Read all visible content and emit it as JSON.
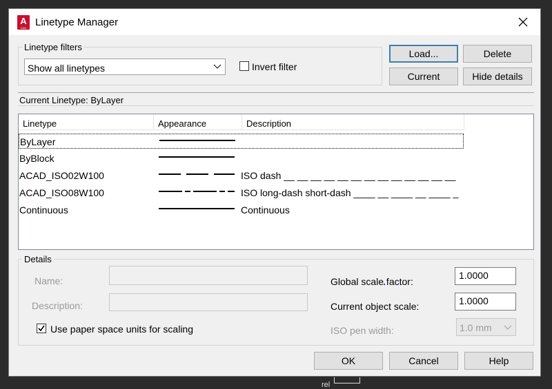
{
  "window": {
    "title": "Linetype Manager",
    "app_icon_letter": "A",
    "app_icon_sub": "CAD"
  },
  "filters": {
    "group_label": "Linetype filters",
    "selected": "Show all linetypes",
    "invert_label": "Invert filter",
    "invert_checked": false
  },
  "buttons": {
    "load": "Load...",
    "delete": "Delete",
    "current": "Current",
    "hide_details": "Hide details",
    "ok": "OK",
    "cancel": "Cancel",
    "help": "Help"
  },
  "current_linetype": {
    "label": "Current Linetype:",
    "value": "ByLayer"
  },
  "table": {
    "columns": [
      "Linetype",
      "Appearance",
      "Description"
    ],
    "rows": [
      {
        "linetype": "ByLayer",
        "appearance": "solid",
        "description": ""
      },
      {
        "linetype": "ByBlock",
        "appearance": "solid",
        "description": ""
      },
      {
        "linetype": "ACAD_ISO02W100",
        "appearance": "dash",
        "description": "ISO dash __ __ __ __ __ __ __ __ __ __ __ __ __"
      },
      {
        "linetype": "ACAD_ISO08W100",
        "appearance": "long-dash-short-dash",
        "description": "ISO long-dash short-dash ____ __ ____ __ ____ _"
      },
      {
        "linetype": "Continuous",
        "appearance": "solid",
        "description": "Continuous"
      }
    ]
  },
  "details": {
    "group_label": "Details",
    "name_label": "Name:",
    "description_label": "Description:",
    "paper_space_label": "Use paper space units for scaling",
    "paper_space_checked": true,
    "global_scale_label": "Global scale factor:",
    "global_scale_value": "1.0000",
    "object_scale_label": "Current object scale:",
    "object_scale_value": "1.0000",
    "iso_pen_label": "ISO pen width:",
    "iso_pen_value": "1.0 mm"
  },
  "underlay": {
    "text": "rel"
  }
}
